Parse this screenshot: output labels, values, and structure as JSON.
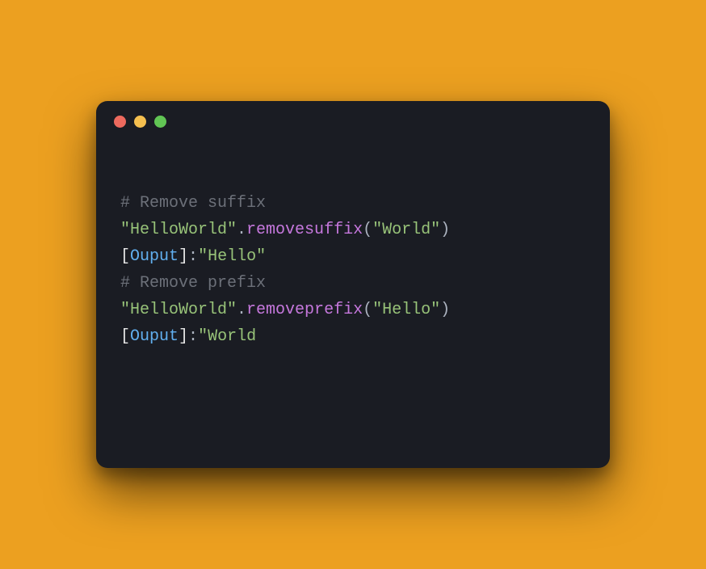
{
  "colors": {
    "background": "#ECA020",
    "window_bg": "#1A1C23",
    "comment": "#6C7079",
    "string": "#98C379",
    "default": "#ABB2BF",
    "method": "#C678DD",
    "bracket": "#E6E6E6",
    "output_label": "#61AFEF"
  },
  "traffic_lights": {
    "red": "#ED6A5E",
    "yellow": "#F5BF4F",
    "green": "#61C554"
  },
  "code": {
    "line1": {
      "comment": "# Remove suffix"
    },
    "line2": {
      "string1": "\"HelloWorld\"",
      "dot": ".",
      "method": "removesuffix",
      "open": "(",
      "string2": "\"World\"",
      "close": ")"
    },
    "line3": {
      "lbracket": "[",
      "output_label": "Ouput",
      "rbracket": "]",
      "colon": ":",
      "string": "\"Hello\""
    },
    "line4": {
      "blank": ""
    },
    "line5": {
      "comment": "# Remove prefix"
    },
    "line6": {
      "string1": "\"HelloWorld\"",
      "dot": ".",
      "method": "removeprefix",
      "open": "(",
      "string2": "\"Hello\"",
      "close": ")"
    },
    "line7": {
      "lbracket": "[",
      "output_label": "Ouput",
      "rbracket": "]",
      "colon": ":",
      "string": "\"World"
    }
  }
}
